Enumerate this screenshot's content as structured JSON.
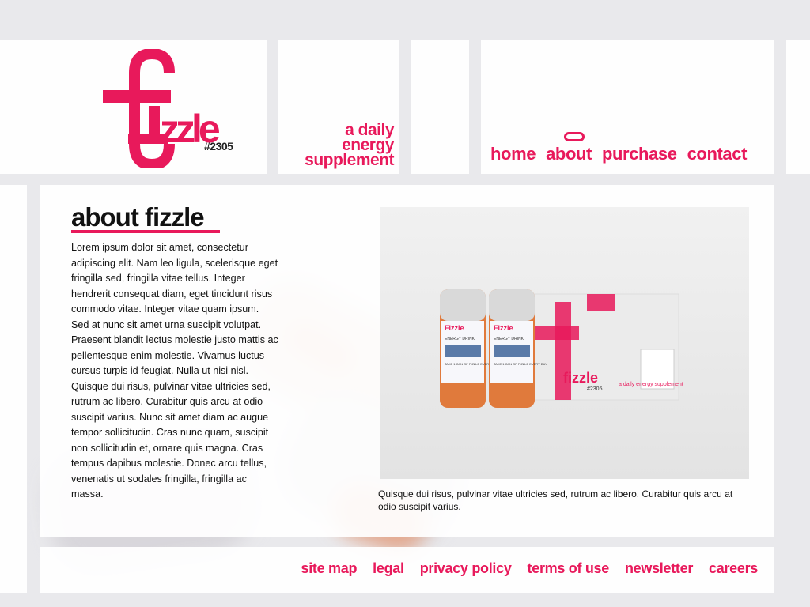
{
  "brand": {
    "logo_text": "fizzle",
    "product_number": "#2305",
    "tagline_lines": [
      "a daily",
      "energy",
      "supplement"
    ],
    "accent_color": "#e8195b"
  },
  "nav": {
    "icon": "capsule-icon",
    "items": [
      {
        "label": "home"
      },
      {
        "label": "about"
      },
      {
        "label": "purchase"
      },
      {
        "label": "contact"
      }
    ]
  },
  "main": {
    "heading": "about fizzle",
    "body": "Lorem ipsum dolor sit amet, consectetur adipiscing elit. Nam leo ligula, scelerisque eget fringilla sed, fringilla vitae tellus. Integer hendrerit consequat diam, eget tincidunt risus commodo vitae. Integer vitae quam ipsum. Sed at nunc sit amet urna suscipit volutpat. Praesent blandit lectus molestie justo mattis ac pellentesque enim molestie. Vivamus luctus cursus turpis id feugiat. Nulla ut nisi nisl. Quisque dui risus, pulvinar vitae ultricies sed, rutrum ac libero. Curabitur quis arcu at odio suscipit varius. Nunc sit amet diam ac augue tempor sollicitudin. Cras nunc quam, suscipit non sollicitudin et, ornare quis magna. Cras tempus dapibus molestie. Donec arcu tellus, venenatis ut sodales fringilla, fringilla ac massa.",
    "caption": "Quisque dui risus, pulvinar vitae ultricies sed, rutrum ac libero. Curabitur quis arcu at odio suscipit varius.",
    "photo": {
      "bottle_brand": "Fizzle",
      "bottle_subtitle": "ENERGY DRINK",
      "bottle_dose": "TAKE 1 CAN OF FIZZLE EVERY DAY",
      "box_logo": "fizzle",
      "box_number": "#2305",
      "box_tagline": "a daily energy supplement"
    }
  },
  "footer": {
    "links": [
      {
        "label": "site map"
      },
      {
        "label": "legal"
      },
      {
        "label": "privacy policy"
      },
      {
        "label": "terms of use"
      },
      {
        "label": "newsletter"
      },
      {
        "label": "careers"
      }
    ]
  }
}
